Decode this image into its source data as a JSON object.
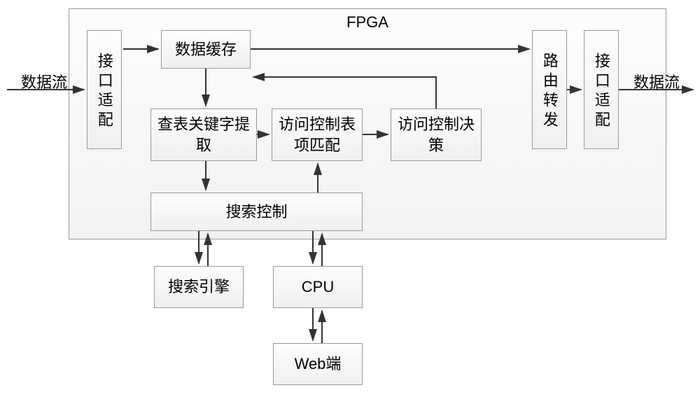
{
  "labels": {
    "dataflow_in": "数据流",
    "dataflow_out": "数据流"
  },
  "fpga": {
    "title": "FPGA",
    "interface_adapter_in": "接口适配",
    "data_cache": "数据缓存",
    "keyword_extract": "查表关键字提取",
    "acl_match": "访问控制表项匹配",
    "acl_decision": "访问控制决策",
    "search_control": "搜索控制",
    "route_forward": "路由转发",
    "interface_adapter_out": "接口适配"
  },
  "external": {
    "search_engine": "搜索引擎",
    "cpu": "CPU",
    "web": "Web端"
  }
}
